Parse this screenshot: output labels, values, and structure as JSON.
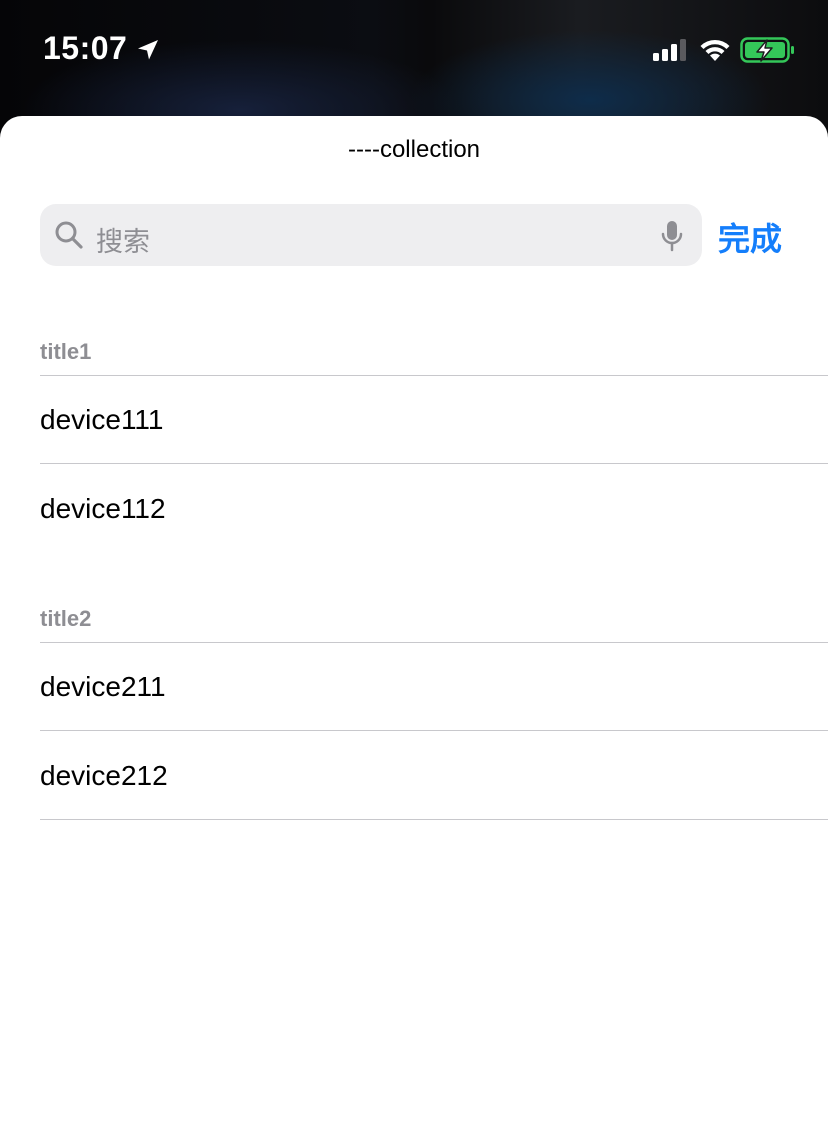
{
  "status_bar": {
    "time": "15:07",
    "icons": [
      "location-arrow-icon",
      "cellular-signal-icon",
      "wifi-icon",
      "battery-charging-icon"
    ],
    "battery_color": "#34c759"
  },
  "sheet": {
    "title": "----collection"
  },
  "search": {
    "placeholder": "搜索",
    "done_label": "完成",
    "accent_color": "#147efb"
  },
  "sections": [
    {
      "header": "title1",
      "rows": [
        "device111",
        "device112"
      ]
    },
    {
      "header": "title2",
      "rows": [
        "device211",
        "device212"
      ]
    }
  ]
}
